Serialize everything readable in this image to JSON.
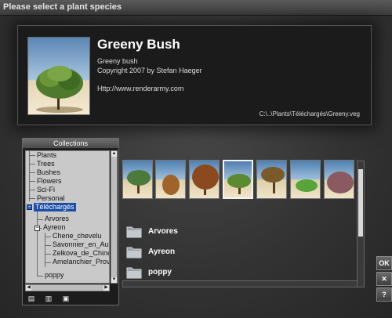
{
  "window": {
    "title": "Please select a plant species"
  },
  "header": {
    "name": "Greeny Bush",
    "description": "Greeny bush",
    "copyright": "Copyright 2007 by Stefan Haeger",
    "url": "Http://www.renderarmy.com",
    "path": "C:\\..\\Plants\\Téléchargés\\Greeny.veg"
  },
  "collections": {
    "title": "Collections",
    "items": [
      {
        "label": "Plants"
      },
      {
        "label": "Trees"
      },
      {
        "label": "Bushes"
      },
      {
        "label": "Flowers"
      },
      {
        "label": "Sci-Fi"
      },
      {
        "label": "Personal"
      },
      {
        "label": "Téléchargés"
      },
      {
        "label": "Arvores"
      },
      {
        "label": "Ayreon"
      },
      {
        "label": "Chene_chevelu"
      },
      {
        "label": "Savonnier_en_Auto"
      },
      {
        "label": "Zelkova_de_Chine"
      },
      {
        "label": "Amelanchier_Prove"
      },
      {
        "label": "poppy"
      }
    ]
  },
  "folders": [
    {
      "label": "Arvores"
    },
    {
      "label": "Ayreon"
    },
    {
      "label": "poppy"
    }
  ],
  "buttons": {
    "ok": "OK",
    "cancel": "✕",
    "help": "?"
  },
  "icons": {
    "expand": "+",
    "collapse": "−",
    "new_collection": "new-collection-icon",
    "delete": "trash-icon",
    "add_folder": "add-folder-icon"
  }
}
